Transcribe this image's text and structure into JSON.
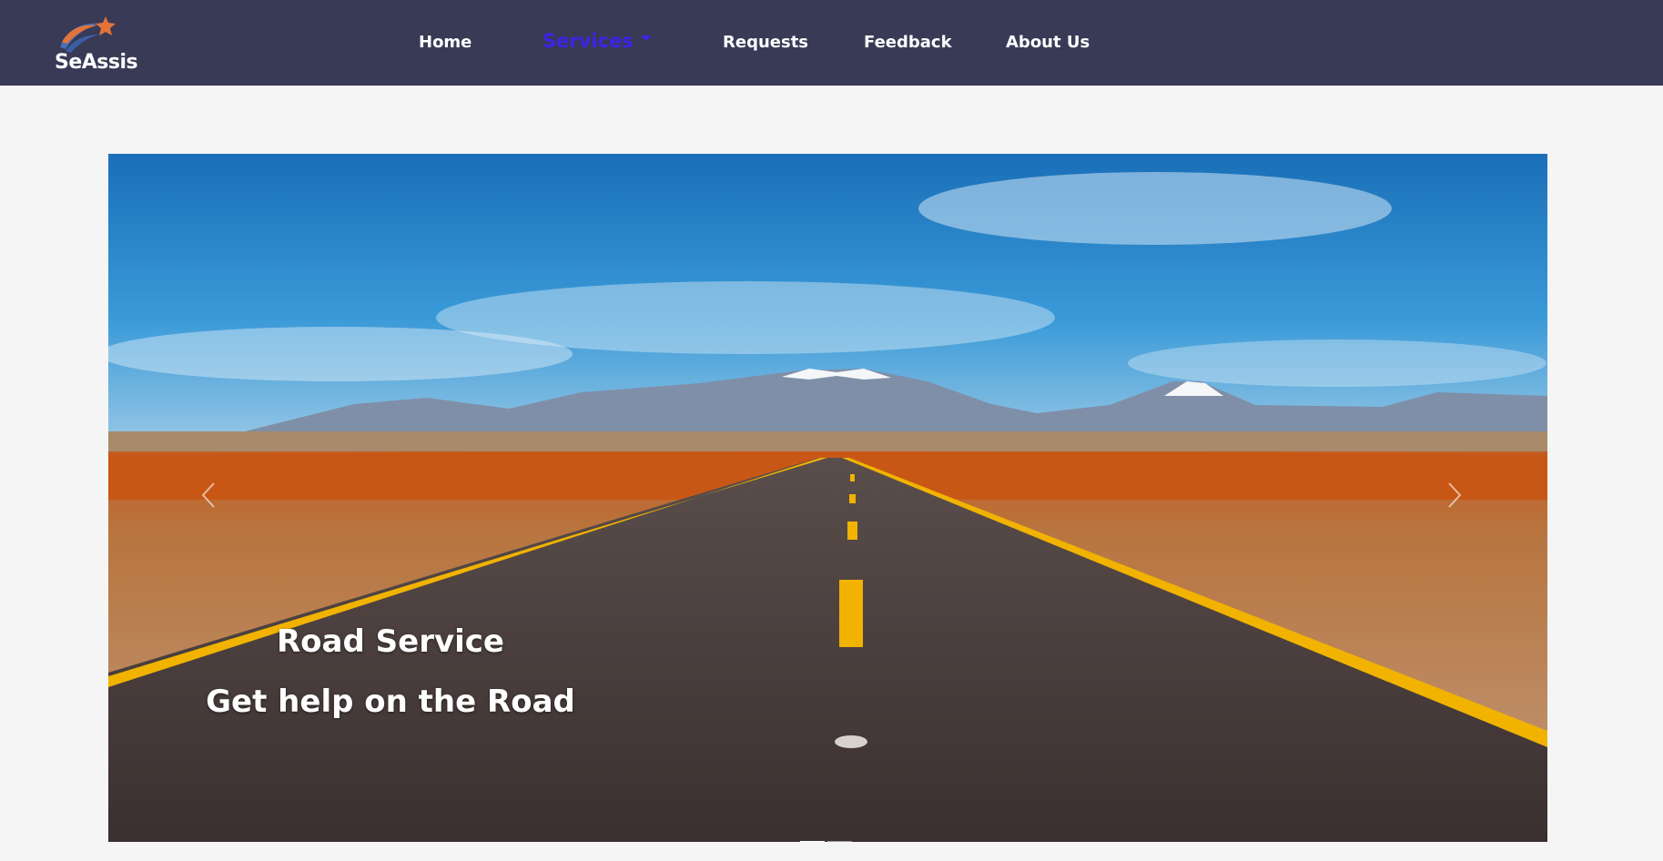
{
  "brand": {
    "name": "SeAssis"
  },
  "nav": {
    "home": "Home",
    "services": "Services",
    "requests": "Requests",
    "feedback": "Feedback",
    "about": "About Us"
  },
  "carousel": {
    "slide_title": "Road Service",
    "slide_subtitle": "Get help on the Road",
    "slide_count": 2,
    "active_slide": 1
  },
  "colors": {
    "navbar": "#383a56",
    "active_link": "#3b25e6",
    "page_bg": "#f5f5f5"
  },
  "icons": [
    "logo-icon",
    "chevron-down-icon",
    "chevron-left-icon",
    "chevron-right-icon"
  ]
}
